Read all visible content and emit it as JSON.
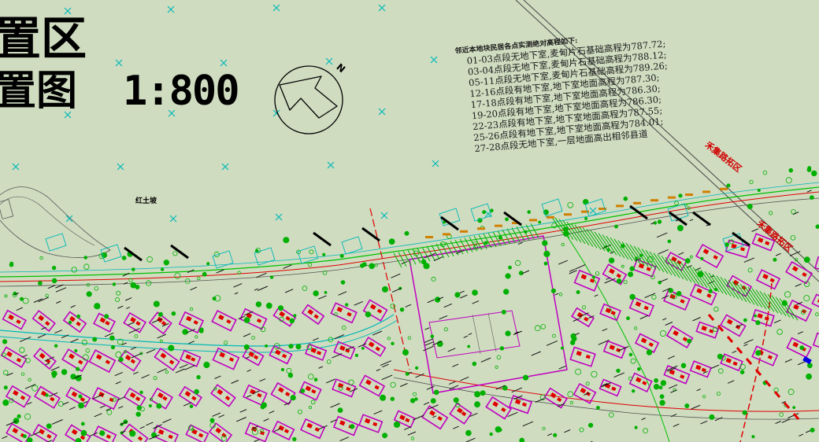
{
  "title": {
    "line1": "置区",
    "line2": "置图",
    "scale": "1:800"
  },
  "north_label": "N",
  "notes": {
    "heading": "邻近本地块民居各点实测绝对高程如下:",
    "lines": [
      "01-03点段无地下室,麦甸片石基础高程为787.72;",
      "03-04点段无地下室,麦甸片石基础高程为788.12;",
      "05-11点段无地下室,麦甸片石基础高程为789.26;",
      "12-16点段有地下室,地下室地面高程为787.30;",
      "17-18点段有地下室,地下室地面高程为786.30;",
      "19-20点段有地下室,地下室地面高程为786.30;",
      "22-23点段有地下室,地下室地面高程为787.55;",
      "25-26点段有地下室,地下室地面高程为784.01;",
      "27-28点段无地下室,一层地面高出相邻县道"
    ]
  },
  "road_labels": [
    "禾集路拓区",
    "禾集路拓区"
  ],
  "place_label": "红土坡",
  "colors": {
    "background": "#cfdcc0",
    "magenta": "#c000c0",
    "red": "#e00000",
    "green": "#00b000",
    "cyan": "#00b8b8",
    "black": "#000000",
    "yellow": "#c8c800"
  }
}
